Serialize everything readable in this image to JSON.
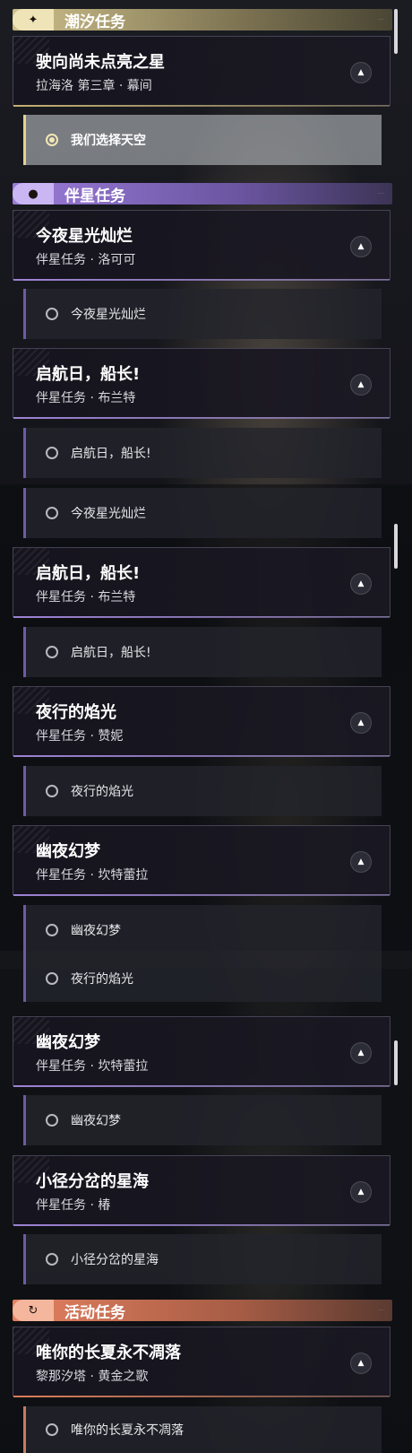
{
  "categories": {
    "tidal": {
      "label": "潮汐任务",
      "icon": "sparkle-icon",
      "color": "#cdbf8a"
    },
    "companion": {
      "label": "伴星任务",
      "icon": "person-icon",
      "color": "#9b7bd8"
    },
    "event": {
      "label": "活动任务",
      "icon": "refresh-icon",
      "color": "#e48060"
    }
  },
  "cards": [
    {
      "title": "驶向尚未点亮之星",
      "subtitle": "拉海洛 第三章 · 幕间"
    },
    {
      "title": "今夜星光灿烂",
      "subtitle": "伴星任务 · 洛可可"
    },
    {
      "title": "启航日，船长!",
      "subtitle": "伴星任务 · 布兰特"
    },
    {
      "title": "启航日，船长!",
      "subtitle": "伴星任务 · 布兰特"
    },
    {
      "title": "夜行的焰光",
      "subtitle": "伴星任务 · 赞妮"
    },
    {
      "title": "幽夜幻梦",
      "subtitle": "伴星任务 · 坎特蕾拉"
    },
    {
      "title": "幽夜幻梦",
      "subtitle": "伴星任务 · 坎特蕾拉"
    },
    {
      "title": "小径分岔的星海",
      "subtitle": "伴星任务 · 椿"
    },
    {
      "title": "唯你的长夏永不凋落",
      "subtitle": "黎那汐塔 · 黄金之歌"
    }
  ],
  "objectives": [
    {
      "text": "我们选择天空",
      "active": true
    },
    {
      "text": "今夜星光灿烂",
      "active": false
    },
    {
      "text": "启航日，船长!",
      "active": false
    },
    {
      "text": "今夜星光灿烂",
      "active": false
    },
    {
      "text": "启航日，船长!",
      "active": false
    },
    {
      "text": "夜行的焰光",
      "active": false
    },
    {
      "text": "幽夜幻梦",
      "active": false
    },
    {
      "text": "夜行的焰光",
      "active": false
    },
    {
      "text": "幽夜幻梦",
      "active": false
    },
    {
      "text": "小径分岔的星海",
      "active": false
    },
    {
      "text": "唯你的长夏永不凋落",
      "active": false
    }
  ],
  "collapse_icon": "chevron-up-icon"
}
